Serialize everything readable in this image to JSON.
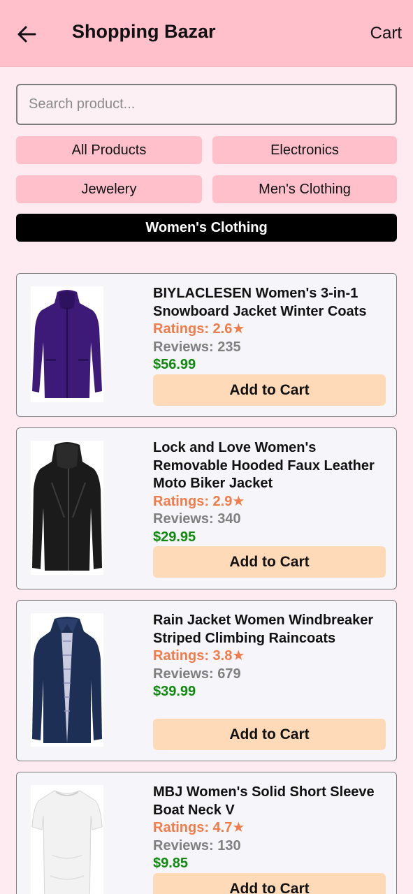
{
  "header": {
    "title": "Shopping Bazar",
    "cart_label": "Cart",
    "back_icon": "arrow-left-icon"
  },
  "search": {
    "placeholder": "Search product...",
    "value": ""
  },
  "categories": [
    {
      "label": "All Products",
      "active": false
    },
    {
      "label": "Electronics",
      "active": false
    },
    {
      "label": "Jewelery",
      "active": false
    },
    {
      "label": "Men's Clothing",
      "active": false
    },
    {
      "label": "Women's Clothing",
      "active": true
    }
  ],
  "products": [
    {
      "title": "BIYLACLESEN Women's 3-in-1 Snowboard Jacket Winter Coats",
      "rating": "Ratings: 2.6★",
      "reviews": "Reviews: 235",
      "price": "$56.99",
      "button": "Add to Cart"
    },
    {
      "title": "Lock and Love Women's Removable Hooded Faux Leather Moto Biker Jacket",
      "rating": "Ratings: 2.9★",
      "reviews": "Reviews: 340",
      "price": "$29.95",
      "button": "Add to Cart"
    },
    {
      "title": "Rain Jacket Women Windbreaker Striped Climbing Raincoats",
      "rating": "Ratings: 3.8★",
      "reviews": "Reviews: 679",
      "price": "$39.99",
      "button": "Add to Cart"
    },
    {
      "title": "MBJ Women's Solid Short Sleeve Boat Neck V",
      "rating": "Ratings: 4.7★",
      "reviews": "Reviews: 130",
      "price": "$9.85",
      "button": "Add to Cart"
    }
  ],
  "colors": {
    "header_bg": "#ffc0cb",
    "page_bg": "#fdebf1",
    "rating": "#f07c4a",
    "reviews": "#808080",
    "price": "#0f8a0f",
    "add_button_bg": "#ffdab9",
    "active_category_bg": "#000000"
  }
}
